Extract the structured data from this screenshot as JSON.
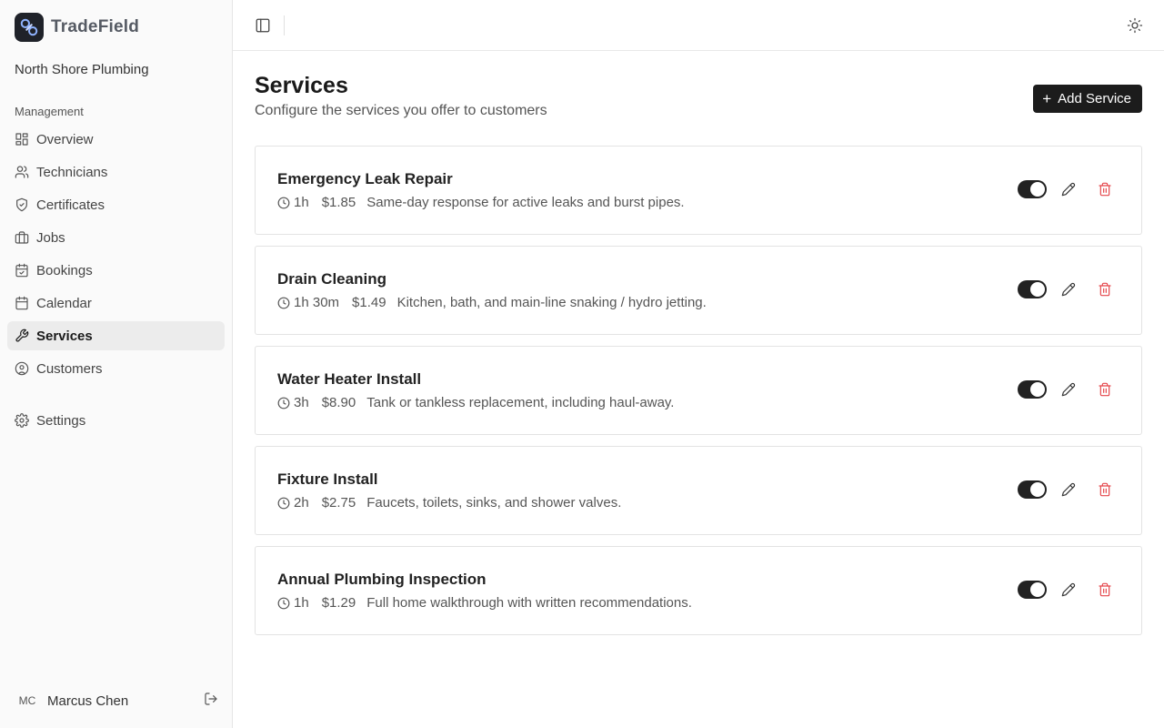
{
  "brand": {
    "name": "TradeField",
    "logo_icon": "link-chain-icon"
  },
  "org": {
    "name": "North Shore Plumbing"
  },
  "nav": {
    "group_label": "Management",
    "items": [
      {
        "label": "Overview",
        "icon": "dashboard-icon",
        "active": false
      },
      {
        "label": "Technicians",
        "icon": "users-icon",
        "active": false
      },
      {
        "label": "Certificates",
        "icon": "shield-check-icon",
        "active": false
      },
      {
        "label": "Jobs",
        "icon": "briefcase-icon",
        "active": false
      },
      {
        "label": "Bookings",
        "icon": "calendar-check-icon",
        "active": false
      },
      {
        "label": "Calendar",
        "icon": "calendar-icon",
        "active": false
      },
      {
        "label": "Services",
        "icon": "wrench-icon",
        "active": true
      },
      {
        "label": "Customers",
        "icon": "user-circle-icon",
        "active": false
      }
    ],
    "settings": {
      "label": "Settings",
      "icon": "gear-icon"
    }
  },
  "user": {
    "initials": "MC",
    "name": "Marcus Chen"
  },
  "page": {
    "title": "Services",
    "subtitle": "Configure the services you offer to customers",
    "add_button_label": "Add Service"
  },
  "services": [
    {
      "name": "Emergency Leak Repair",
      "duration": "1h",
      "price": "$1.85",
      "description": "Same-day response for active leaks and burst pipes.",
      "enabled": true
    },
    {
      "name": "Drain Cleaning",
      "duration": "1h 30m",
      "price": "$1.49",
      "description": "Kitchen, bath, and main-line snaking / hydro jetting.",
      "enabled": true
    },
    {
      "name": "Water Heater Install",
      "duration": "3h",
      "price": "$8.90",
      "description": "Tank or tankless replacement, including haul-away.",
      "enabled": true
    },
    {
      "name": "Fixture Install",
      "duration": "2h",
      "price": "$2.75",
      "description": "Faucets, toilets, sinks, and shower valves.",
      "enabled": true
    },
    {
      "name": "Annual Plumbing Inspection",
      "duration": "1h",
      "price": "$1.29",
      "description": "Full home walkthrough with written recommendations.",
      "enabled": true
    }
  ],
  "colors": {
    "accent": "#1c1c1c",
    "danger": "#e5484d",
    "sidebar_bg": "#fafafa",
    "active_nav_bg": "#ececec"
  }
}
